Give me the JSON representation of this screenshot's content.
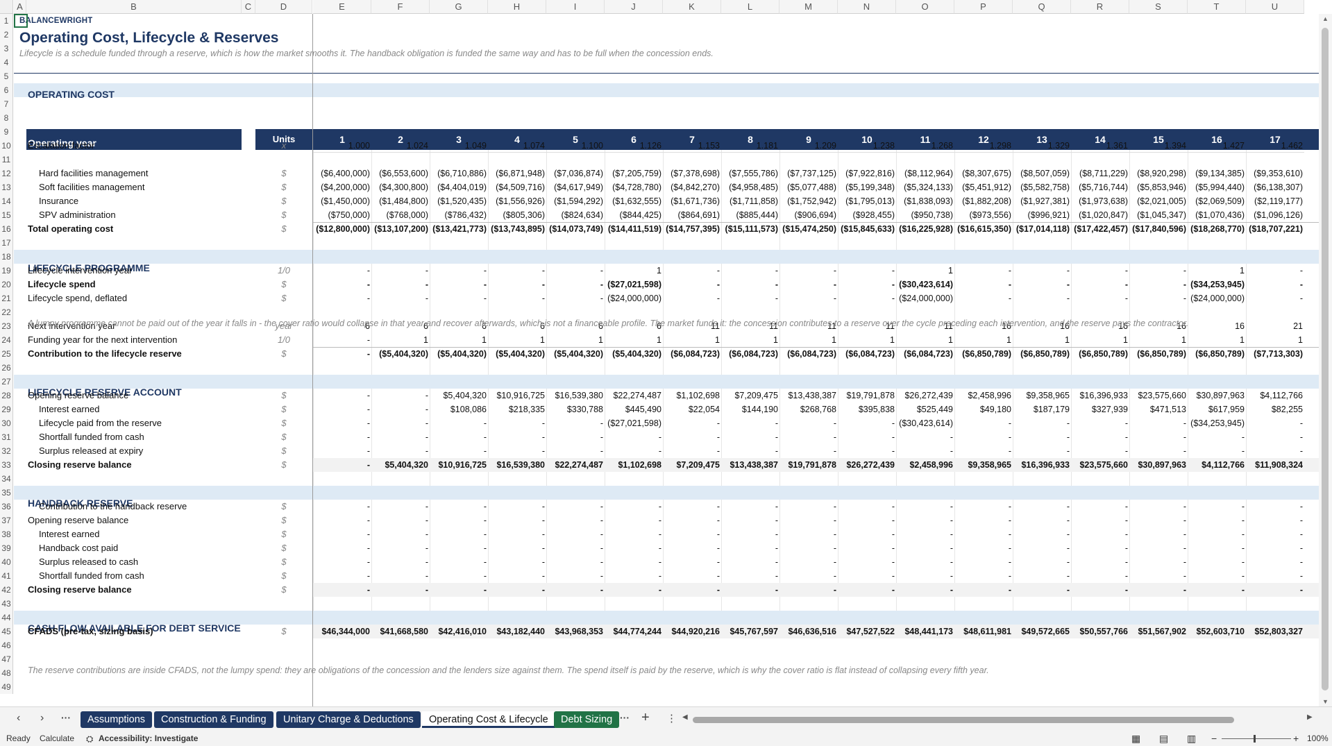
{
  "columns": [
    "A",
    "B",
    "C",
    "D",
    "E",
    "F",
    "G",
    "H",
    "I",
    "J",
    "K",
    "L",
    "M",
    "N",
    "O",
    "P",
    "Q",
    "R",
    "S",
    "T",
    "U"
  ],
  "rows": [
    "1",
    "2",
    "3",
    "4",
    "5",
    "6",
    "7",
    "8",
    "9",
    "10",
    "11",
    "12",
    "13",
    "14",
    "15",
    "16",
    "17",
    "18",
    "19",
    "20",
    "21",
    "22",
    "23",
    "24",
    "25",
    "26",
    "27",
    "28",
    "29",
    "30",
    "31",
    "32",
    "33",
    "34",
    "35",
    "36",
    "37",
    "38",
    "39",
    "40",
    "41",
    "42",
    "43",
    "44",
    "45",
    "46",
    "47",
    "48",
    "49"
  ],
  "brand": "BALANCEWRIGHT",
  "title": "Operating Cost, Lifecycle & Reserves",
  "subtitle": "Lifecycle is a schedule funded through a reserve, which is how the market smooths it. The handback obligation is funded the same way and has to be full when the concession ends.",
  "sections": {
    "operating": "OPERATING COST",
    "lifecycle": "LIFECYCLE PROGRAMME",
    "reserve": "LIFECYCLE RESERVE ACCOUNT",
    "handback": "HANDBACK RESERVE",
    "cfads": "CASH FLOW AVAILABLE FOR DEBT SERVICE"
  },
  "header": {
    "label": "Operating year",
    "units": "Units",
    "years": [
      "1",
      "2",
      "3",
      "4",
      "5",
      "6",
      "7",
      "8",
      "9",
      "10",
      "11",
      "12",
      "13",
      "14",
      "15",
      "16",
      "17"
    ]
  },
  "table_rows": [
    {
      "row": 10,
      "label": "Escalation factor",
      "indent": 0,
      "bold": false,
      "unit": "x",
      "values": [
        "1.000",
        "1.024",
        "1.049",
        "1.074",
        "1.100",
        "1.126",
        "1.153",
        "1.181",
        "1.209",
        "1.238",
        "1.268",
        "1.298",
        "1.329",
        "1.361",
        "1.394",
        "1.427",
        "1.462"
      ]
    },
    {
      "row": 12,
      "label": "Hard facilities management",
      "indent": 1,
      "bold": false,
      "unit": "$",
      "values": [
        "($6,400,000)",
        "($6,553,600)",
        "($6,710,886)",
        "($6,871,948)",
        "($7,036,874)",
        "($7,205,759)",
        "($7,378,698)",
        "($7,555,786)",
        "($7,737,125)",
        "($7,922,816)",
        "($8,112,964)",
        "($8,307,675)",
        "($8,507,059)",
        "($8,711,229)",
        "($8,920,298)",
        "($9,134,385)",
        "($9,353,610)"
      ]
    },
    {
      "row": 13,
      "label": "Soft facilities management",
      "indent": 1,
      "bold": false,
      "unit": "$",
      "values": [
        "($4,200,000)",
        "($4,300,800)",
        "($4,404,019)",
        "($4,509,716)",
        "($4,617,949)",
        "($4,728,780)",
        "($4,842,270)",
        "($4,958,485)",
        "($5,077,488)",
        "($5,199,348)",
        "($5,324,133)",
        "($5,451,912)",
        "($5,582,758)",
        "($5,716,744)",
        "($5,853,946)",
        "($5,994,440)",
        "($6,138,307)"
      ]
    },
    {
      "row": 14,
      "label": "Insurance",
      "indent": 1,
      "bold": false,
      "unit": "$",
      "values": [
        "($1,450,000)",
        "($1,484,800)",
        "($1,520,435)",
        "($1,556,926)",
        "($1,594,292)",
        "($1,632,555)",
        "($1,671,736)",
        "($1,711,858)",
        "($1,752,942)",
        "($1,795,013)",
        "($1,838,093)",
        "($1,882,208)",
        "($1,927,381)",
        "($1,973,638)",
        "($2,021,005)",
        "($2,069,509)",
        "($2,119,177)"
      ]
    },
    {
      "row": 15,
      "label": "SPV administration",
      "indent": 1,
      "bold": false,
      "unit": "$",
      "values": [
        "($750,000)",
        "($768,000)",
        "($786,432)",
        "($805,306)",
        "($824,634)",
        "($844,425)",
        "($864,691)",
        "($885,444)",
        "($906,694)",
        "($928,455)",
        "($950,738)",
        "($973,556)",
        "($996,921)",
        "($1,020,847)",
        "($1,045,347)",
        "($1,070,436)",
        "($1,096,126)"
      ]
    },
    {
      "row": 16,
      "label": "Total operating cost",
      "indent": 0,
      "bold": true,
      "unit": "$",
      "values": [
        "($12,800,000)",
        "($13,107,200)",
        "($13,421,773)",
        "($13,743,895)",
        "($14,073,749)",
        "($14,411,519)",
        "($14,757,395)",
        "($15,111,573)",
        "($15,474,250)",
        "($15,845,633)",
        "($16,225,928)",
        "($16,615,350)",
        "($17,014,118)",
        "($17,422,457)",
        "($17,840,596)",
        "($18,268,770)",
        "($18,707,221)"
      ]
    },
    {
      "row": 19,
      "label": "Lifecycle intervention year",
      "indent": 0,
      "bold": false,
      "unit": "1/0",
      "values": [
        "-",
        "-",
        "-",
        "-",
        "-",
        "1",
        "-",
        "-",
        "-",
        "-",
        "1",
        "-",
        "-",
        "-",
        "-",
        "1",
        "-"
      ]
    },
    {
      "row": 20,
      "label": "Lifecycle spend",
      "indent": 0,
      "bold": true,
      "unit": "$",
      "values": [
        "-",
        "-",
        "-",
        "-",
        "-",
        "($27,021,598)",
        "-",
        "-",
        "-",
        "-",
        "($30,423,614)",
        "-",
        "-",
        "-",
        "-",
        "($34,253,945)",
        "-"
      ]
    },
    {
      "row": 21,
      "label": "Lifecycle spend, deflated",
      "indent": 0,
      "bold": false,
      "unit": "$",
      "values": [
        "-",
        "-",
        "-",
        "-",
        "-",
        "($24,000,000)",
        "-",
        "-",
        "-",
        "-",
        "($24,000,000)",
        "-",
        "-",
        "-",
        "-",
        "($24,000,000)",
        "-"
      ]
    },
    {
      "row": 23,
      "label": "Next intervention year",
      "indent": 0,
      "bold": false,
      "unit": "year",
      "values": [
        "6",
        "6",
        "6",
        "6",
        "6",
        "6",
        "11",
        "11",
        "11",
        "11",
        "11",
        "16",
        "16",
        "16",
        "16",
        "16",
        "21"
      ]
    },
    {
      "row": 24,
      "label": "Funding year for the next intervention",
      "indent": 0,
      "bold": false,
      "unit": "1/0",
      "values": [
        "-",
        "1",
        "1",
        "1",
        "1",
        "1",
        "1",
        "1",
        "1",
        "1",
        "1",
        "1",
        "1",
        "1",
        "1",
        "1",
        "1"
      ]
    },
    {
      "row": 25,
      "label": "Contribution to the lifecycle reserve",
      "indent": 0,
      "bold": true,
      "unit": "$",
      "values": [
        "-",
        "($5,404,320)",
        "($5,404,320)",
        "($5,404,320)",
        "($5,404,320)",
        "($5,404,320)",
        "($6,084,723)",
        "($6,084,723)",
        "($6,084,723)",
        "($6,084,723)",
        "($6,084,723)",
        "($6,850,789)",
        "($6,850,789)",
        "($6,850,789)",
        "($6,850,789)",
        "($6,850,789)",
        "($7,713,303)"
      ]
    },
    {
      "row": 28,
      "label": "Opening reserve balance",
      "indent": 0,
      "bold": false,
      "unit": "$",
      "values": [
        "-",
        "-",
        "$5,404,320",
        "$10,916,725",
        "$16,539,380",
        "$22,274,487",
        "$1,102,698",
        "$7,209,475",
        "$13,438,387",
        "$19,791,878",
        "$26,272,439",
        "$2,458,996",
        "$9,358,965",
        "$16,396,933",
        "$23,575,660",
        "$30,897,963",
        "$4,112,766"
      ]
    },
    {
      "row": 29,
      "label": "Interest earned",
      "indent": 1,
      "bold": false,
      "unit": "$",
      "values": [
        "-",
        "-",
        "$108,086",
        "$218,335",
        "$330,788",
        "$445,490",
        "$22,054",
        "$144,190",
        "$268,768",
        "$395,838",
        "$525,449",
        "$49,180",
        "$187,179",
        "$327,939",
        "$471,513",
        "$617,959",
        "$82,255"
      ]
    },
    {
      "row": 30,
      "label": "Lifecycle paid from the reserve",
      "indent": 1,
      "bold": false,
      "unit": "$",
      "values": [
        "-",
        "-",
        "-",
        "-",
        "-",
        "($27,021,598)",
        "-",
        "-",
        "-",
        "-",
        "($30,423,614)",
        "-",
        "-",
        "-",
        "-",
        "($34,253,945)",
        "-"
      ]
    },
    {
      "row": 31,
      "label": "Shortfall funded from cash",
      "indent": 1,
      "bold": false,
      "unit": "$",
      "values": [
        "-",
        "-",
        "-",
        "-",
        "-",
        "-",
        "-",
        "-",
        "-",
        "-",
        "-",
        "-",
        "-",
        "-",
        "-",
        "-",
        "-"
      ]
    },
    {
      "row": 32,
      "label": "Surplus released at expiry",
      "indent": 1,
      "bold": false,
      "unit": "$",
      "values": [
        "-",
        "-",
        "-",
        "-",
        "-",
        "-",
        "-",
        "-",
        "-",
        "-",
        "-",
        "-",
        "-",
        "-",
        "-",
        "-",
        "-"
      ]
    },
    {
      "row": 33,
      "label": "Closing reserve balance",
      "indent": 0,
      "bold": true,
      "unit": "$",
      "values": [
        "-",
        "$5,404,320",
        "$10,916,725",
        "$16,539,380",
        "$22,274,487",
        "$1,102,698",
        "$7,209,475",
        "$13,438,387",
        "$19,791,878",
        "$26,272,439",
        "$2,458,996",
        "$9,358,965",
        "$16,396,933",
        "$23,575,660",
        "$30,897,963",
        "$4,112,766",
        "$11,908,324"
      ]
    },
    {
      "row": 36,
      "label": "Contribution to the handback reserve",
      "indent": 1,
      "bold": false,
      "unit": "$",
      "values": [
        "-",
        "-",
        "-",
        "-",
        "-",
        "-",
        "-",
        "-",
        "-",
        "-",
        "-",
        "-",
        "-",
        "-",
        "-",
        "-",
        "-"
      ]
    },
    {
      "row": 37,
      "label": "Opening reserve balance",
      "indent": 0,
      "bold": false,
      "unit": "$",
      "values": [
        "-",
        "-",
        "-",
        "-",
        "-",
        "-",
        "-",
        "-",
        "-",
        "-",
        "-",
        "-",
        "-",
        "-",
        "-",
        "-",
        "-"
      ]
    },
    {
      "row": 38,
      "label": "Interest earned",
      "indent": 1,
      "bold": false,
      "unit": "$",
      "values": [
        "-",
        "-",
        "-",
        "-",
        "-",
        "-",
        "-",
        "-",
        "-",
        "-",
        "-",
        "-",
        "-",
        "-",
        "-",
        "-",
        "-"
      ]
    },
    {
      "row": 39,
      "label": "Handback cost paid",
      "indent": 1,
      "bold": false,
      "unit": "$",
      "values": [
        "-",
        "-",
        "-",
        "-",
        "-",
        "-",
        "-",
        "-",
        "-",
        "-",
        "-",
        "-",
        "-",
        "-",
        "-",
        "-",
        "-"
      ]
    },
    {
      "row": 40,
      "label": "Surplus released to cash",
      "indent": 1,
      "bold": false,
      "unit": "$",
      "values": [
        "-",
        "-",
        "-",
        "-",
        "-",
        "-",
        "-",
        "-",
        "-",
        "-",
        "-",
        "-",
        "-",
        "-",
        "-",
        "-",
        "-"
      ]
    },
    {
      "row": 41,
      "label": "Shortfall funded from cash",
      "indent": 1,
      "bold": false,
      "unit": "$",
      "values": [
        "-",
        "-",
        "-",
        "-",
        "-",
        "-",
        "-",
        "-",
        "-",
        "-",
        "-",
        "-",
        "-",
        "-",
        "-",
        "-",
        "-"
      ]
    },
    {
      "row": 42,
      "label": "Closing reserve balance",
      "indent": 0,
      "bold": true,
      "unit": "$",
      "values": [
        "-",
        "-",
        "-",
        "-",
        "-",
        "-",
        "-",
        "-",
        "-",
        "-",
        "-",
        "-",
        "-",
        "-",
        "-",
        "-",
        "-"
      ]
    },
    {
      "row": 45,
      "label": "CFADS (pre-tax, sizing basis)",
      "indent": 0,
      "bold": true,
      "unit": "$",
      "values": [
        "$46,344,000",
        "$41,668,580",
        "$42,416,010",
        "$43,182,440",
        "$43,968,353",
        "$44,774,244",
        "$44,920,216",
        "$45,767,597",
        "$46,636,516",
        "$47,527,522",
        "$48,441,173",
        "$48,611,981",
        "$49,572,665",
        "$50,557,766",
        "$51,567,902",
        "$52,603,710",
        "$52,803,327"
      ]
    }
  ],
  "note22": "A lumpy programme cannot be paid out of the year it falls in - the cover ratio would collapse in that year and recover afterwards, which is not a financeable profile. The market funds it: the concession contributes to a reserve over the cycle preceding each intervention, and the reserve pays the contractor.",
  "note47": "The reserve contributions are inside CFADS, not the lumpy spend: they are obligations of the concession and the lenders size against them. The spend itself is paid by the reserve, which is why the cover ratio is flat instead of collapsing every fifth year.",
  "tabs": {
    "t1": "Assumptions",
    "t2": "Construction & Funding",
    "t3": "Unitary Charge & Deductions",
    "t4": "Operating Cost & Lifecycle",
    "t5": "Debt Sizing",
    "more": "···",
    "add": "+",
    "options": "⋮"
  },
  "status": {
    "ready": "Ready",
    "calculate": "Calculate",
    "accessibility": "Accessibility: Investigate",
    "zoom": "100%"
  },
  "colors": {
    "navy": "#1f3864",
    "band": "#deeaf5",
    "green_tab": "#217346"
  }
}
